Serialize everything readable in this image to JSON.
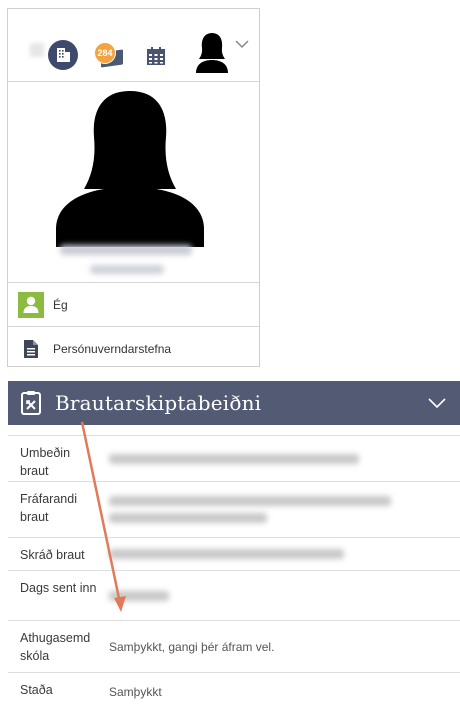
{
  "profile": {
    "org_badge_count": "284",
    "menu": [
      {
        "label": "Ég",
        "icon": "user-icon"
      },
      {
        "label": "Persónuverndarstefna",
        "icon": "document-icon"
      }
    ]
  },
  "panel": {
    "title": "Brautarskiptabeiðni",
    "rows": [
      {
        "label": "Umbeðin braut",
        "value": ""
      },
      {
        "label": "Fráfarandi braut",
        "value": ""
      },
      {
        "label": "Skráð braut",
        "value": ""
      },
      {
        "label": "Dags sent inn",
        "value": ""
      },
      {
        "label": "Athugasemd skóla",
        "value": "Samþykkt, gangi þér áfram vel."
      },
      {
        "label": "Staða",
        "value": "Samþykkt"
      }
    ]
  },
  "colors": {
    "header_bg": "#525a74",
    "accent_green": "#8dbb3f",
    "annotation_arrow": "#e07b5a"
  }
}
